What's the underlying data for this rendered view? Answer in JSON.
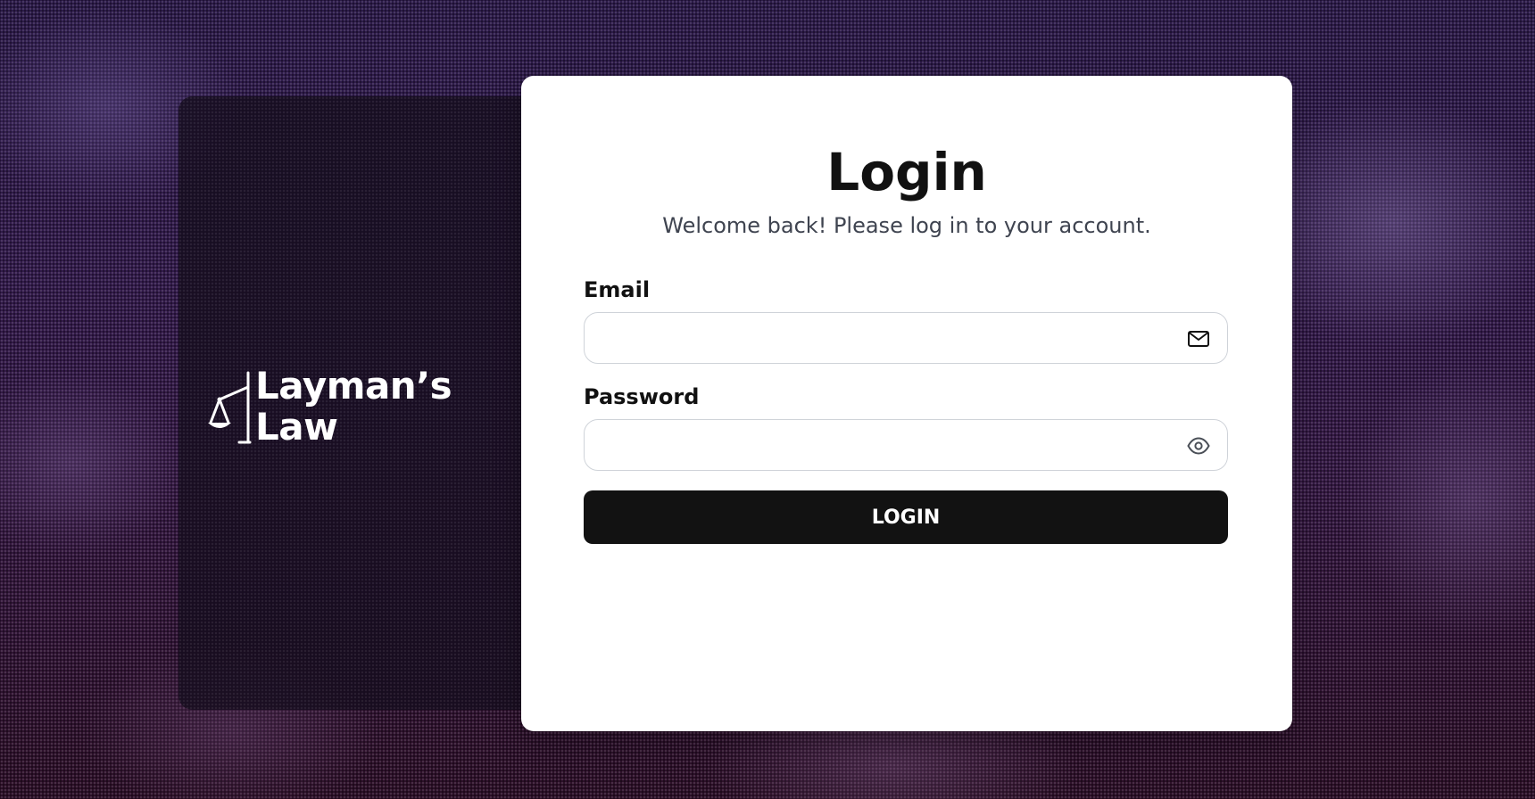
{
  "brand": {
    "line1": "Layman’s",
    "line2": "Law"
  },
  "login": {
    "title": "Login",
    "subtitle": "Welcome back! Please log in to your account.",
    "email_label": "Email",
    "email_value": "",
    "password_label": "Password",
    "password_value": "",
    "submit_label": "LOGIN"
  },
  "icons": {
    "email_field": "envelope-icon",
    "password_field": "eye-icon",
    "logo": "scales-of-justice-icon"
  },
  "colors": {
    "background": "#2f1a48",
    "card": "#ffffff",
    "button": "#121212",
    "button_text": "#ffffff"
  }
}
